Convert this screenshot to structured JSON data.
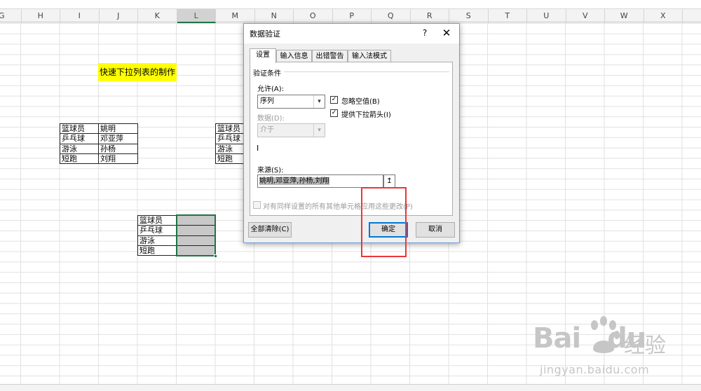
{
  "columns": [
    "G",
    "H",
    "I",
    "J",
    "K",
    "L",
    "M",
    "N",
    "O",
    "P",
    "Q",
    "R",
    "S",
    "T",
    "U",
    "V",
    "W",
    "X"
  ],
  "selected_column": "L",
  "title_cell": "快速下拉列表的制作",
  "table1": [
    [
      "篮球员",
      "姚明"
    ],
    [
      "乒乓球",
      "邓亚萍"
    ],
    [
      "游泳",
      "孙杨"
    ],
    [
      "短跑",
      "刘翔"
    ]
  ],
  "table2": [
    "篮球员",
    "乒乓球",
    "游泳",
    "短跑"
  ],
  "table3": [
    "篮球员",
    "乒乓球",
    "游泳",
    "短跑"
  ],
  "dialog": {
    "title": "数据验证",
    "help": "?",
    "close": "✕",
    "tabs": [
      "设置",
      "输入信息",
      "出错警告",
      "输入法模式"
    ],
    "active_tab": "设置",
    "group_label": "验证条件",
    "allow_label": "允许(A):",
    "allow_value": "序列",
    "data_label": "数据(D):",
    "data_value": "介于",
    "ignore_blank_label": "忽略空值(B)",
    "ignore_blank_checked": true,
    "dropdown_label": "提供下拉箭头(I)",
    "dropdown_checked": true,
    "source_label": "来源(S):",
    "source_value": "姚明,邓亚萍,孙杨,刘翔",
    "apply_all_label": "对有同样设置的所有其他单元格应用这些更改(P)",
    "apply_all_checked": false,
    "clear_button": "全部清除(C)",
    "ok_button": "确定",
    "cancel_button": "取消"
  },
  "icons": {
    "checkmark": "✓",
    "dropdown_arrow": "▾",
    "collapse": "↥"
  },
  "colors": {
    "highlight_yellow": "#ffff00",
    "selection_green": "#217346",
    "annotation_red": "#e8373c"
  },
  "watermark": {
    "logo": "Bai",
    "logo_tail": "du",
    "cn": "经验",
    "url": "jingyan.baidu.com"
  }
}
